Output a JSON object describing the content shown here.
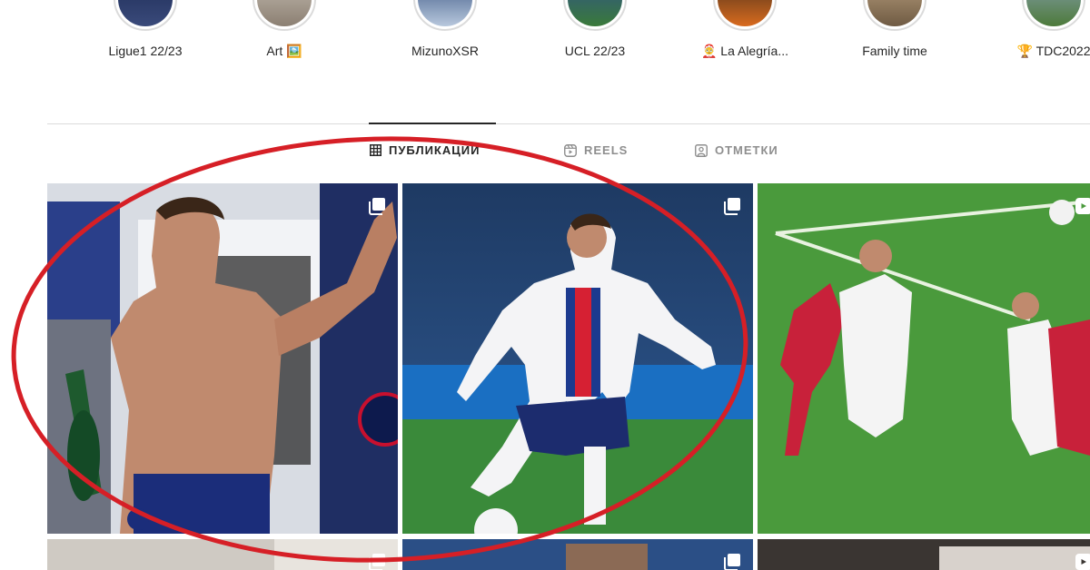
{
  "highlights": [
    {
      "label": "Ligue1 22/23",
      "icon": "photo"
    },
    {
      "label": "Art 🖼️",
      "icon": "photo"
    },
    {
      "label": "MizunoXSR",
      "icon": "photo"
    },
    {
      "label": "UCL 22/23",
      "icon": "photo"
    },
    {
      "label": "🤶 La Alegría...",
      "icon": "photo"
    },
    {
      "label": "Family time",
      "icon": "photo"
    },
    {
      "label": "🏆 TDC2022",
      "icon": "photo"
    }
  ],
  "tabs": [
    {
      "label": "ПУБЛИКАЦИИ",
      "icon": "grid-icon",
      "active": true
    },
    {
      "label": "REELS",
      "icon": "reels-icon",
      "active": false
    },
    {
      "label": "ОТМЕТКИ",
      "icon": "tagged-icon",
      "active": false
    }
  ],
  "posts": [
    {
      "kind": "carousel",
      "subject": "Celebration in locker room with champagne"
    },
    {
      "kind": "carousel",
      "subject": "Player kicking ball in PSG kit"
    },
    {
      "kind": "reel",
      "subject": "Header goal in match"
    },
    {
      "kind": "photo",
      "subject": ""
    },
    {
      "kind": "carousel",
      "subject": ""
    },
    {
      "kind": "photo",
      "subject": ""
    }
  ],
  "annotation_color": "#d61f26"
}
